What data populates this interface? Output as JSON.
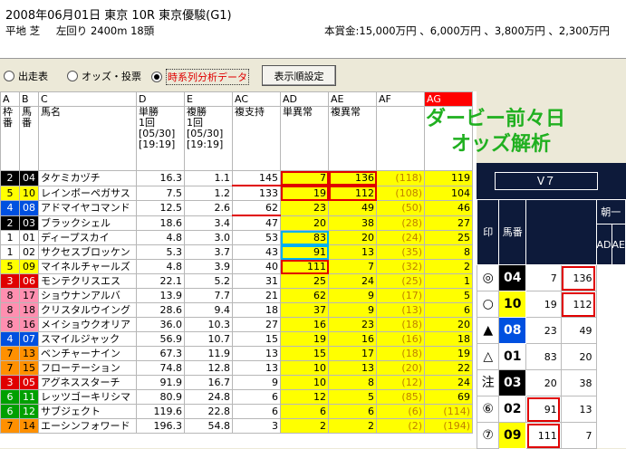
{
  "race": {
    "line1": "2008年06月01日 東京  10R  東京優駿(G1)",
    "surface": "平地  芝",
    "course": "左回り  2400m 18頭",
    "prize": "本賞金:15,000万円 、6,000万円 、3,800万円 、2,300万円"
  },
  "toolbar": {
    "radio1": "出走表",
    "radio2": "オッズ・投票",
    "radio3": "時系列分析データ",
    "button": "表示順設定"
  },
  "columns": {
    "letters": [
      "A",
      "B",
      "C",
      "D",
      "E",
      "AC",
      "AD",
      "AE",
      "AF",
      "AG"
    ],
    "headers": [
      "枠番",
      "馬番",
      "馬名",
      "単勝\n1回\n[05/30]\n[19:19]",
      "複勝\n1回\n[05/30]\n[19:19]",
      "複支持",
      "単異常",
      "複異常",
      "",
      ""
    ]
  },
  "rows": [
    {
      "waku": "2",
      "umaban": "04",
      "name": "タケミカヅチ",
      "tan": "16.3",
      "fuku": "1.1",
      "ac": "145",
      "ad": "7",
      "ae": "136",
      "af": "(118)",
      "ag": "119"
    },
    {
      "waku": "5",
      "umaban": "10",
      "name": "レインボーペガサス",
      "tan": "7.5",
      "fuku": "1.2",
      "ac": "133",
      "ad": "19",
      "ae": "112",
      "af": "(108)",
      "ag": "104"
    },
    {
      "waku": "4",
      "umaban": "08",
      "name": "アドマイヤコマンド",
      "tan": "12.5",
      "fuku": "2.6",
      "ac": "62",
      "ad": "23",
      "ae": "49",
      "af": "(50)",
      "ag": "46"
    },
    {
      "waku": "2",
      "umaban": "03",
      "name": "ブラックシェル",
      "tan": "18.6",
      "fuku": "3.4",
      "ac": "47",
      "ad": "20",
      "ae": "38",
      "af": "(28)",
      "ag": "27"
    },
    {
      "waku": "1",
      "umaban": "01",
      "name": "ディープスカイ",
      "tan": "4.8",
      "fuku": "3.0",
      "ac": "53",
      "ad": "83",
      "ae": "20",
      "af": "(24)",
      "ag": "25"
    },
    {
      "waku": "1",
      "umaban": "02",
      "name": "サクセスブロッケン",
      "tan": "5.3",
      "fuku": "3.7",
      "ac": "43",
      "ad": "91",
      "ae": "13",
      "af": "(35)",
      "ag": "8"
    },
    {
      "waku": "5",
      "umaban": "09",
      "name": "マイネルチャールズ",
      "tan": "4.8",
      "fuku": "3.9",
      "ac": "40",
      "ad": "111",
      "ae": "7",
      "af": "(32)",
      "ag": "2"
    },
    {
      "waku": "3",
      "umaban": "06",
      "name": "モンテクリスエス",
      "tan": "22.1",
      "fuku": "5.2",
      "ac": "31",
      "ad": "25",
      "ae": "24",
      "af": "(25)",
      "ag": "1"
    },
    {
      "waku": "8",
      "umaban": "17",
      "name": "ショウナンアルバ",
      "tan": "13.9",
      "fuku": "7.7",
      "ac": "21",
      "ad": "62",
      "ae": "9",
      "af": "(17)",
      "ag": "5"
    },
    {
      "waku": "8",
      "umaban": "18",
      "name": "クリスタルウイング",
      "tan": "28.6",
      "fuku": "9.4",
      "ac": "18",
      "ad": "37",
      "ae": "9",
      "af": "(13)",
      "ag": "6"
    },
    {
      "waku": "8",
      "umaban": "16",
      "name": "メイショウクオリア",
      "tan": "36.0",
      "fuku": "10.3",
      "ac": "27",
      "ad": "16",
      "ae": "23",
      "af": "(18)",
      "ag": "20"
    },
    {
      "waku": "4",
      "umaban": "07",
      "name": "スマイルジャック",
      "tan": "56.9",
      "fuku": "10.7",
      "ac": "15",
      "ad": "19",
      "ae": "16",
      "af": "(16)",
      "ag": "18"
    },
    {
      "waku": "7",
      "umaban": "13",
      "name": "ベンチャーナイン",
      "tan": "67.3",
      "fuku": "11.9",
      "ac": "13",
      "ad": "15",
      "ae": "17",
      "af": "(18)",
      "ag": "19"
    },
    {
      "waku": "7",
      "umaban": "15",
      "name": "フローテーション",
      "tan": "74.8",
      "fuku": "12.8",
      "ac": "13",
      "ad": "10",
      "ae": "13",
      "af": "(20)",
      "ag": "22"
    },
    {
      "waku": "3",
      "umaban": "05",
      "name": "アグネススターチ",
      "tan": "91.9",
      "fuku": "16.7",
      "ac": "9",
      "ad": "10",
      "ae": "8",
      "af": "(12)",
      "ag": "24"
    },
    {
      "waku": "6",
      "umaban": "11",
      "name": "レッツゴーキリシマ",
      "tan": "80.9",
      "fuku": "24.8",
      "ac": "6",
      "ad": "12",
      "ae": "5",
      "af": "(85)",
      "ag": "69"
    },
    {
      "waku": "6",
      "umaban": "12",
      "name": "サブジェクト",
      "tan": "119.6",
      "fuku": "22.8",
      "ac": "6",
      "ad": "6",
      "ae": "6",
      "af": "(6)",
      "ag": "(114)"
    },
    {
      "waku": "7",
      "umaban": "14",
      "name": "エーシンフォワード",
      "tan": "196.3",
      "fuku": "54.8",
      "ac": "3",
      "ad": "2",
      "ae": "2",
      "af": "(2)",
      "ag": "(194)"
    }
  ],
  "banner": {
    "line1": "ダービー前々日",
    "line2": "オッズ解析"
  },
  "panel": {
    "title": "V７",
    "group": "朝一",
    "col_mark": "印",
    "col_uma": "馬番",
    "col_ad": "AD",
    "col_ae": "AE",
    "rows": [
      {
        "mark": "◎",
        "uma": "04",
        "ad": "7",
        "ae": "136"
      },
      {
        "mark": "○",
        "uma": "10",
        "ad": "19",
        "ae": "112"
      },
      {
        "mark": "▲",
        "uma": "08",
        "ad": "23",
        "ae": "49"
      },
      {
        "mark": "△",
        "uma": "01",
        "ad": "83",
        "ae": "20"
      },
      {
        "mark": "注",
        "uma": "03",
        "ad": "20",
        "ae": "38"
      },
      {
        "mark": "⑥",
        "uma": "02",
        "ad": "91",
        "ae": "13"
      },
      {
        "mark": "⑦",
        "uma": "09",
        "ad": "111",
        "ae": "7"
      }
    ]
  }
}
